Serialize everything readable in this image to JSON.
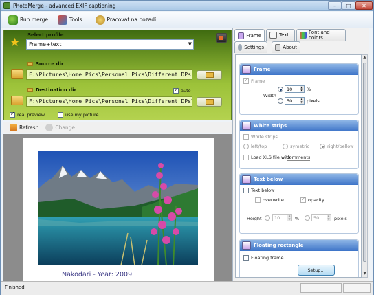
{
  "window": {
    "title": "PhotoMerge - advanced EXIF captioning",
    "controls": {
      "minimize": "–",
      "maximize": "□",
      "close": "✕"
    }
  },
  "toolbar": {
    "run_merge": "Run merge",
    "tools": "Tools",
    "background": "Pracovat na pozadí"
  },
  "profile": {
    "label": "Select profile",
    "value": "Frame+text"
  },
  "source": {
    "label": "Source dir",
    "path": "F:\\Pictures\\Home Pics\\Personal Pics\\Different DPs"
  },
  "destination": {
    "label": "Destination dir",
    "path": "F:\\Pictures\\Home Pics\\Personal Pics\\Different DPs\\PMout",
    "auto_label": "auto",
    "auto": true
  },
  "options": {
    "real_preview_label": "real preview",
    "real_preview": true,
    "use_my_picture_label": "use my picture",
    "use_my_picture": false
  },
  "actions": {
    "refresh": "Refresh",
    "change": "Change"
  },
  "preview": {
    "caption": "Nakodari - Year: 2009"
  },
  "tabs": {
    "frame": "Frame",
    "text": "Text",
    "font_colors": "Font and colors",
    "settings": "Settings",
    "about": "About"
  },
  "frame_section": {
    "title": "Frame",
    "frame_label": "Frame",
    "width_label": "Width",
    "percent_value": "10",
    "percent_unit": "%",
    "pixels_value": "50",
    "pixels_unit": "pixels"
  },
  "strips_section": {
    "title": "White strips",
    "strips_label": "White strips",
    "left_top": "left/top",
    "symetric": "symetric",
    "right_bellow": "right/bellow",
    "load_xls_label": "Load XLS file with",
    "comments_link": "comments"
  },
  "text_below_section": {
    "title": "Text below",
    "text_below_label": "Text below",
    "overwrite_label": "overwrite",
    "opacity_label": "opacity",
    "height_label": "Height",
    "percent_value": "10",
    "percent_unit": "%",
    "pixels_value": "50",
    "pixels_unit": "pixels"
  },
  "floating_section": {
    "title": "Floating rectangle",
    "floating_label": "Floating frame",
    "setup_button": "Setup..."
  },
  "status": {
    "text": "Finished"
  }
}
